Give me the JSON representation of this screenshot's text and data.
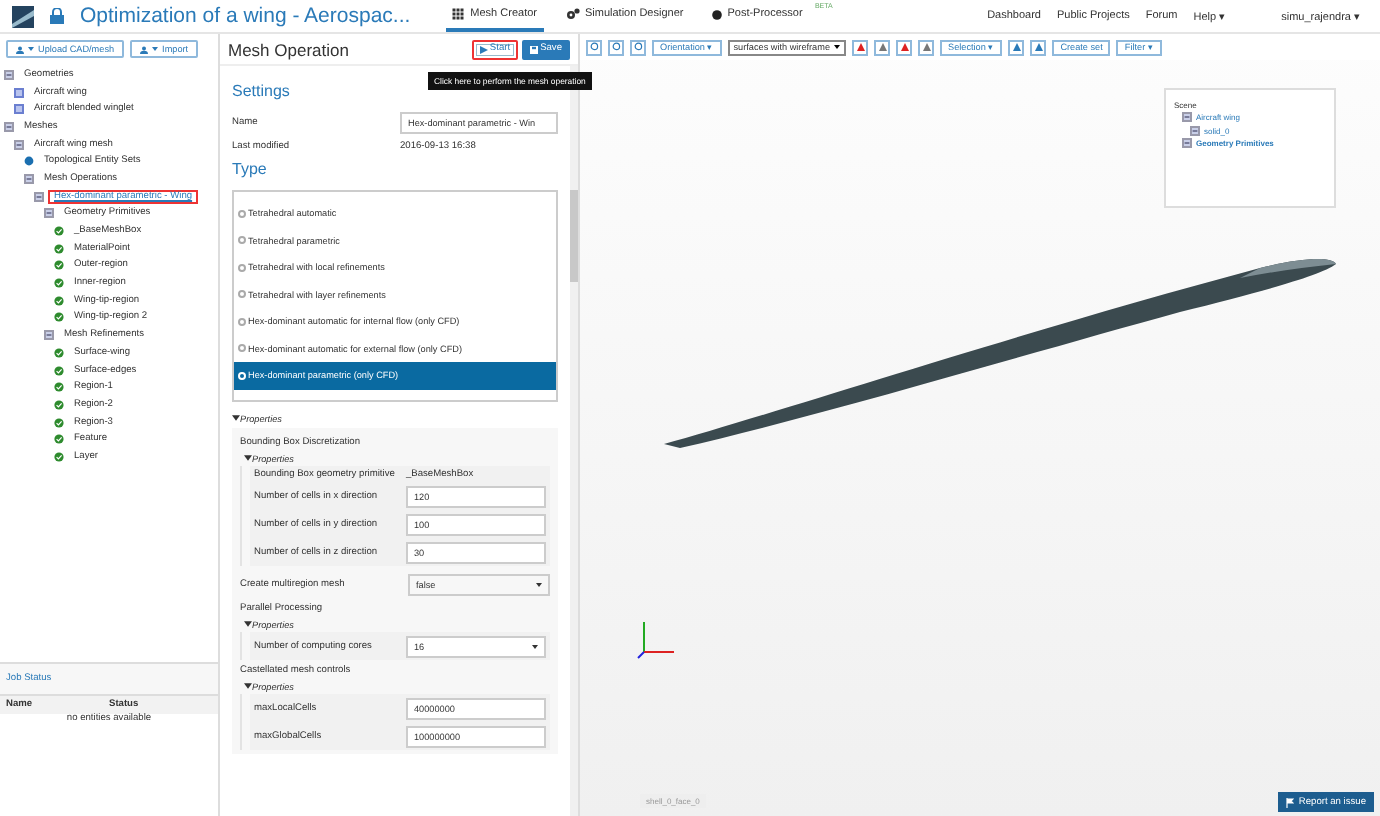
{
  "header": {
    "title": "Optimization of a wing - Aerospac...",
    "nav": [
      {
        "label": "Mesh Creator",
        "selected": true,
        "kind": "grid"
      },
      {
        "label": "Simulation Designer",
        "selected": false,
        "kind": "gears"
      },
      {
        "label": "Post-Processor",
        "selected": false,
        "kind": "dot",
        "badge": "BETA"
      }
    ],
    "links": [
      "Dashboard",
      "Public Projects",
      "Forum",
      "Help ▾"
    ],
    "user": "simu_rajendra ▾"
  },
  "left": {
    "buttons": [
      "Upload CAD/mesh",
      "Import"
    ],
    "tree": [
      {
        "label": "Geometries",
        "kind": "folder",
        "selected": false,
        "highlighted": false,
        "children": [
          {
            "label": "Aircraft wing",
            "kind": "geometry",
            "selected": false,
            "highlighted": false
          },
          {
            "label": "Aircraft blended winglet",
            "kind": "geometry",
            "selected": false,
            "highlighted": false
          }
        ]
      },
      {
        "label": "Meshes",
        "kind": "folder",
        "selected": false,
        "highlighted": false,
        "children": [
          {
            "label": "Aircraft wing mesh",
            "kind": "folder",
            "selected": false,
            "highlighted": false,
            "children": [
              {
                "label": "Topological Entity Sets",
                "kind": "dot",
                "selected": false,
                "highlighted": false
              },
              {
                "label": "Mesh Operations",
                "kind": "folder",
                "selected": false,
                "highlighted": false,
                "children": [
                  {
                    "label": "Hex-dominant parametric - Wing",
                    "kind": "folder",
                    "selected": true,
                    "highlighted": true,
                    "children": [
                      {
                        "label": "Geometry Primitives",
                        "kind": "folder",
                        "selected": false,
                        "highlighted": false,
                        "children": [
                          {
                            "label": "_BaseMeshBox",
                            "kind": "check",
                            "selected": false,
                            "highlighted": false
                          },
                          {
                            "label": "MaterialPoint",
                            "kind": "check",
                            "selected": false,
                            "highlighted": false
                          },
                          {
                            "label": "Outer-region",
                            "kind": "check",
                            "selected": false,
                            "highlighted": false
                          },
                          {
                            "label": "Inner-region",
                            "kind": "check",
                            "selected": false,
                            "highlighted": false
                          },
                          {
                            "label": "Wing-tip-region",
                            "kind": "check",
                            "selected": false,
                            "highlighted": false
                          },
                          {
                            "label": "Wing-tip-region 2",
                            "kind": "check",
                            "selected": false,
                            "highlighted": false
                          }
                        ]
                      },
                      {
                        "label": "Mesh Refinements",
                        "kind": "folder",
                        "selected": false,
                        "highlighted": false,
                        "children": [
                          {
                            "label": "Surface-wing",
                            "kind": "check",
                            "selected": false,
                            "highlighted": false
                          },
                          {
                            "label": "Surface-edges",
                            "kind": "check",
                            "selected": false,
                            "highlighted": false
                          },
                          {
                            "label": "Region-1",
                            "kind": "check",
                            "selected": false,
                            "highlighted": false
                          },
                          {
                            "label": "Region-2",
                            "kind": "check",
                            "selected": false,
                            "highlighted": false
                          },
                          {
                            "label": "Region-3",
                            "kind": "check",
                            "selected": false,
                            "highlighted": false
                          },
                          {
                            "label": "Feature",
                            "kind": "check",
                            "selected": false,
                            "highlighted": false
                          },
                          {
                            "label": "Layer",
                            "kind": "check",
                            "selected": false,
                            "highlighted": false
                          }
                        ]
                      }
                    ]
                  }
                ]
              }
            ]
          }
        ]
      }
    ],
    "job_status": {
      "title": "Job Status",
      "columns": [
        "Name",
        "Status"
      ],
      "empty": "no entities available"
    }
  },
  "panel": {
    "title": "Mesh Operation",
    "actions": [
      {
        "label": "Start",
        "kind": "start",
        "highlighted": true
      },
      {
        "label": "Save",
        "kind": "save",
        "highlighted": false
      }
    ],
    "tooltip": "Click here to perform the mesh operation",
    "settings_title": "Settings",
    "name_label": "Name",
    "name_value": "Hex-dominant parametric - Win",
    "modified_label": "Last modified",
    "modified_value": "2016-09-13 16:38",
    "type_title": "Type",
    "types": [
      {
        "label": "Tetrahedral automatic",
        "selected": false
      },
      {
        "label": "Tetrahedral parametric",
        "selected": false
      },
      {
        "label": "Tetrahedral with local refinements",
        "selected": false
      },
      {
        "label": "Tetrahedral with layer refinements",
        "selected": false
      },
      {
        "label": "Hex-dominant automatic for internal flow (only CFD)",
        "selected": false
      },
      {
        "label": "Hex-dominant automatic for external flow (only CFD)",
        "selected": false
      },
      {
        "label": "Hex-dominant parametric (only CFD)",
        "selected": true
      }
    ],
    "properties_label": "Properties",
    "sections": [
      {
        "title": "Bounding Box Discretization",
        "kind": "group",
        "properties_label": "Properties",
        "fields": [
          {
            "label": "Bounding Box geometry primitive",
            "value": "_BaseMeshBox",
            "kind": "text"
          },
          {
            "label": "Number of cells in x direction",
            "value": "120",
            "kind": "input"
          },
          {
            "label": "Number of cells in y direction",
            "value": "100",
            "kind": "input"
          },
          {
            "label": "Number of cells in z direction",
            "value": "30",
            "kind": "input"
          }
        ]
      },
      {
        "title": "Create multiregion mesh",
        "kind": "select",
        "value": "false"
      },
      {
        "title": "Parallel Processing",
        "kind": "group",
        "properties_label": "Properties",
        "fields": [
          {
            "label": "Number of computing cores",
            "value": "16",
            "kind": "select"
          }
        ]
      },
      {
        "title": "Castellated mesh controls",
        "kind": "group",
        "properties_label": "Properties",
        "fields": [
          {
            "label": "maxLocalCells",
            "value": "40000000",
            "kind": "input"
          },
          {
            "label": "maxGlobalCells",
            "value": "100000000",
            "kind": "input"
          }
        ]
      }
    ]
  },
  "viewer": {
    "toolbar": [
      {
        "kind": "dropdown",
        "label": "Orientation ▾"
      },
      {
        "kind": "select",
        "label": "surfaces with wireframe"
      },
      {
        "kind": "render_icons"
      },
      {
        "kind": "dropdown",
        "label": "Selection ▾"
      },
      {
        "kind": "selection_icons"
      },
      {
        "kind": "dropdown",
        "label": "Create set"
      },
      {
        "kind": "dropdown",
        "label": "Filter ▾"
      }
    ],
    "scene": {
      "title": "Scene",
      "items": [
        {
          "label": "Aircraft wing",
          "children": [
            {
              "label": "solid_0"
            }
          ]
        },
        {
          "label": "Geometry Primitives"
        }
      ]
    },
    "status": "shell_0_face_0",
    "report": "Report an issue"
  }
}
